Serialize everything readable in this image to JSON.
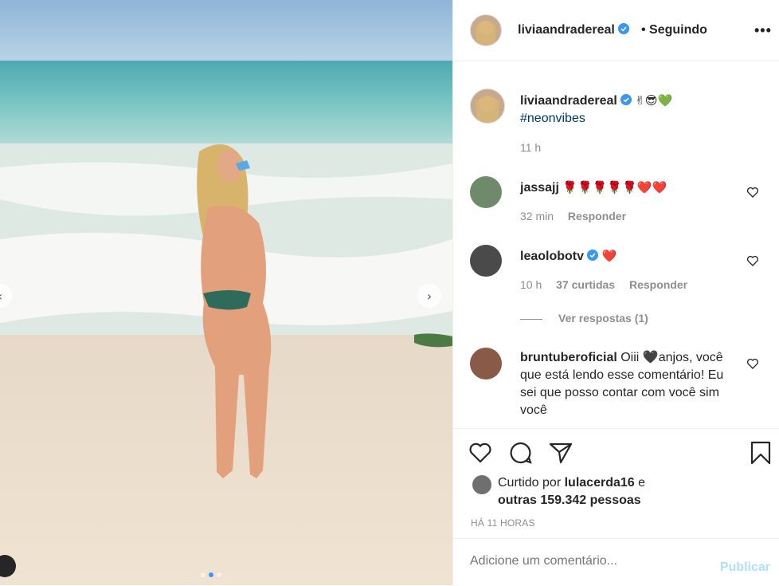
{
  "post": {
    "author": "liviaandradereal",
    "follow_status": "• Seguindo",
    "more_label": "•••"
  },
  "caption": {
    "author": "liviaandradereal",
    "emojis": "✌😎💚",
    "hashtag": "#neonvibes",
    "time": "11 h"
  },
  "comments": [
    {
      "author": "jassajj",
      "text": "🌹🌹🌹🌹🌹❤️❤️",
      "time": "32 min",
      "reply": "Responder"
    },
    {
      "author": "leaolobotv",
      "text": "❤️",
      "time": "10 h",
      "likes": "37 curtidas",
      "reply": "Responder",
      "view_replies": "Ver respostas (1)"
    },
    {
      "author": "bruntuberoficial",
      "text": "Oiii 🖤anjos, você que está lendo esse comentário! Eu sei que posso contar com você sim você"
    }
  ],
  "likes": {
    "prefix": "Curtido por",
    "user": "lulacerda16",
    "connector": "e",
    "others": "outras 159.342 pessoas"
  },
  "posted_ago": "HÁ 11 HORAS",
  "add_comment": {
    "placeholder": "Adicione um comentário...",
    "publish": "Publicar"
  },
  "carousel": {
    "slide_count": 3,
    "active_slide": 2
  },
  "colors": {
    "verified": "#3897f0",
    "hashtag": "#00376b",
    "publish_disabled": "#b2dffc"
  }
}
